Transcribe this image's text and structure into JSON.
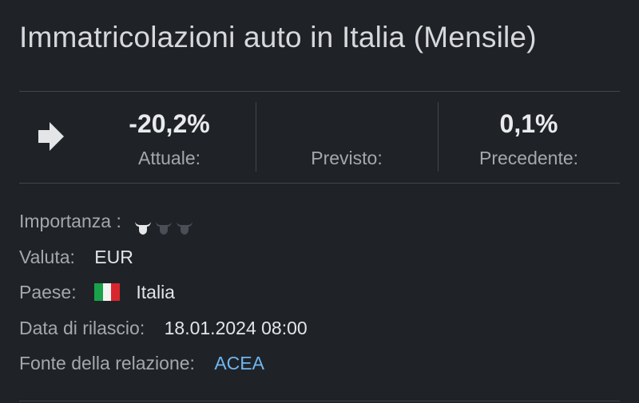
{
  "title": "Immatricolazioni auto in Italia (Mensile)",
  "stats": {
    "actual_value": "-20,2%",
    "actual_label": "Attuale:",
    "forecast_value": "",
    "forecast_label": "Previsto:",
    "previous_value": "0,1%",
    "previous_label": "Precedente:",
    "trend_icon": "arrow-right-icon"
  },
  "details": {
    "importance_label": "Importanza :",
    "importance_level": 1,
    "importance_max": 3,
    "currency_label": "Valuta:",
    "currency_value": "EUR",
    "country_label": "Paese:",
    "country_value": "Italia",
    "country_flag": "italy-flag-icon",
    "release_label": "Data di rilascio:",
    "release_value": "18.01.2024 08:00",
    "source_label": "Fonte della relazione:",
    "source_value": "ACEA"
  },
  "colors": {
    "background": "#1f2328",
    "link": "#6fb6ef",
    "bull_active": "#e6e7e9",
    "bull_inactive": "#4a4f55",
    "flag_green": "#1aa24a",
    "flag_white": "#f4f4f4",
    "flag_red": "#d9262e"
  }
}
